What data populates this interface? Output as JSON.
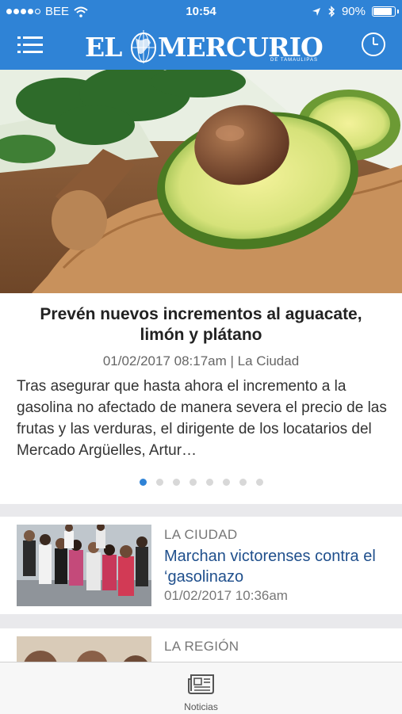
{
  "status_bar": {
    "carrier": "BEE",
    "time": "10:54",
    "battery": "90%",
    "battery_level": 0.9
  },
  "header": {
    "logo_el": "EL",
    "logo_mercurio": "MERCURIO",
    "logo_subtitle": "DE TAMAULIPAS",
    "menu_icon": "hamburger-menu-icon",
    "history_icon": "clock-icon"
  },
  "featured": {
    "title": "Prevén nuevos incrementos al aguacate, limón y plátano",
    "meta": "01/02/2017 08:17am | La Ciudad",
    "excerpt": "Tras asegurar que hasta ahora el incremento a la gasolina no afectado de manera severa el precio de las frutas y las verduras, el dirigente de los locatarios del Mercado Argüelles, Artur…",
    "pager_total": 8,
    "pager_active": 1
  },
  "articles": [
    {
      "category": "LA CIUDAD",
      "title": "Marchan victorenses contra el ‘gasolinazo",
      "date": "01/02/2017 10:36am"
    },
    {
      "category": "LA REGIÓN",
      "title": "",
      "date": ""
    }
  ],
  "tabbar": {
    "label": "Noticias",
    "icon": "newspaper-icon"
  },
  "colors": {
    "brand": "#2f83d6",
    "link": "#1f4f8c"
  }
}
